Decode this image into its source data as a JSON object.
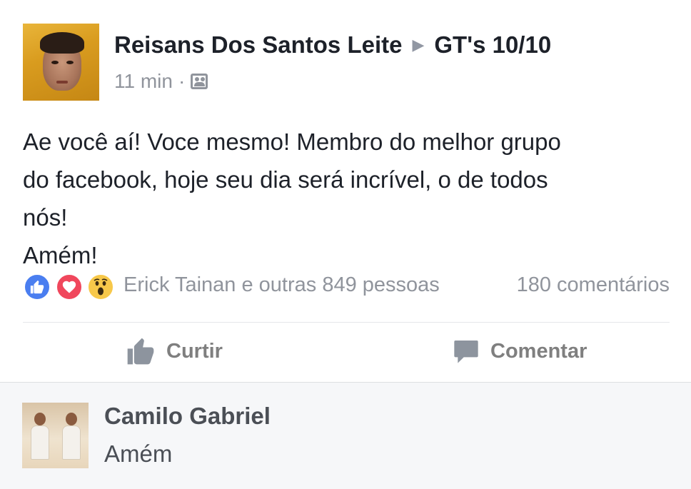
{
  "post": {
    "author": "Reisans Dos Santos Leite",
    "arrow": "▶",
    "group": "GT's 10/10",
    "time": "11 min",
    "separator": "·",
    "audience_icon": "group-icon",
    "lines": [
      "Ae você aí! Voce mesmo! Membro do melhor grupo",
      "do facebook, hoje seu dia será incrível, o de todos",
      "nós!",
      "Amém!"
    ]
  },
  "reactions": {
    "icons": [
      "like-reaction-icon",
      "love-reaction-icon",
      "wow-reaction-icon"
    ],
    "names": "Erick Tainan e outras 849 pessoas",
    "comments": "180 comentários"
  },
  "actions": {
    "like_label": "Curtir",
    "comment_label": "Comentar"
  },
  "comment": {
    "author": "Camilo Gabriel",
    "text": "Amém"
  },
  "colors": {
    "like": "#4a7ef0",
    "love": "#f0475c",
    "wow": "#f7c84a",
    "muted": "#90949c",
    "comment_bg": "#f6f7f9"
  }
}
